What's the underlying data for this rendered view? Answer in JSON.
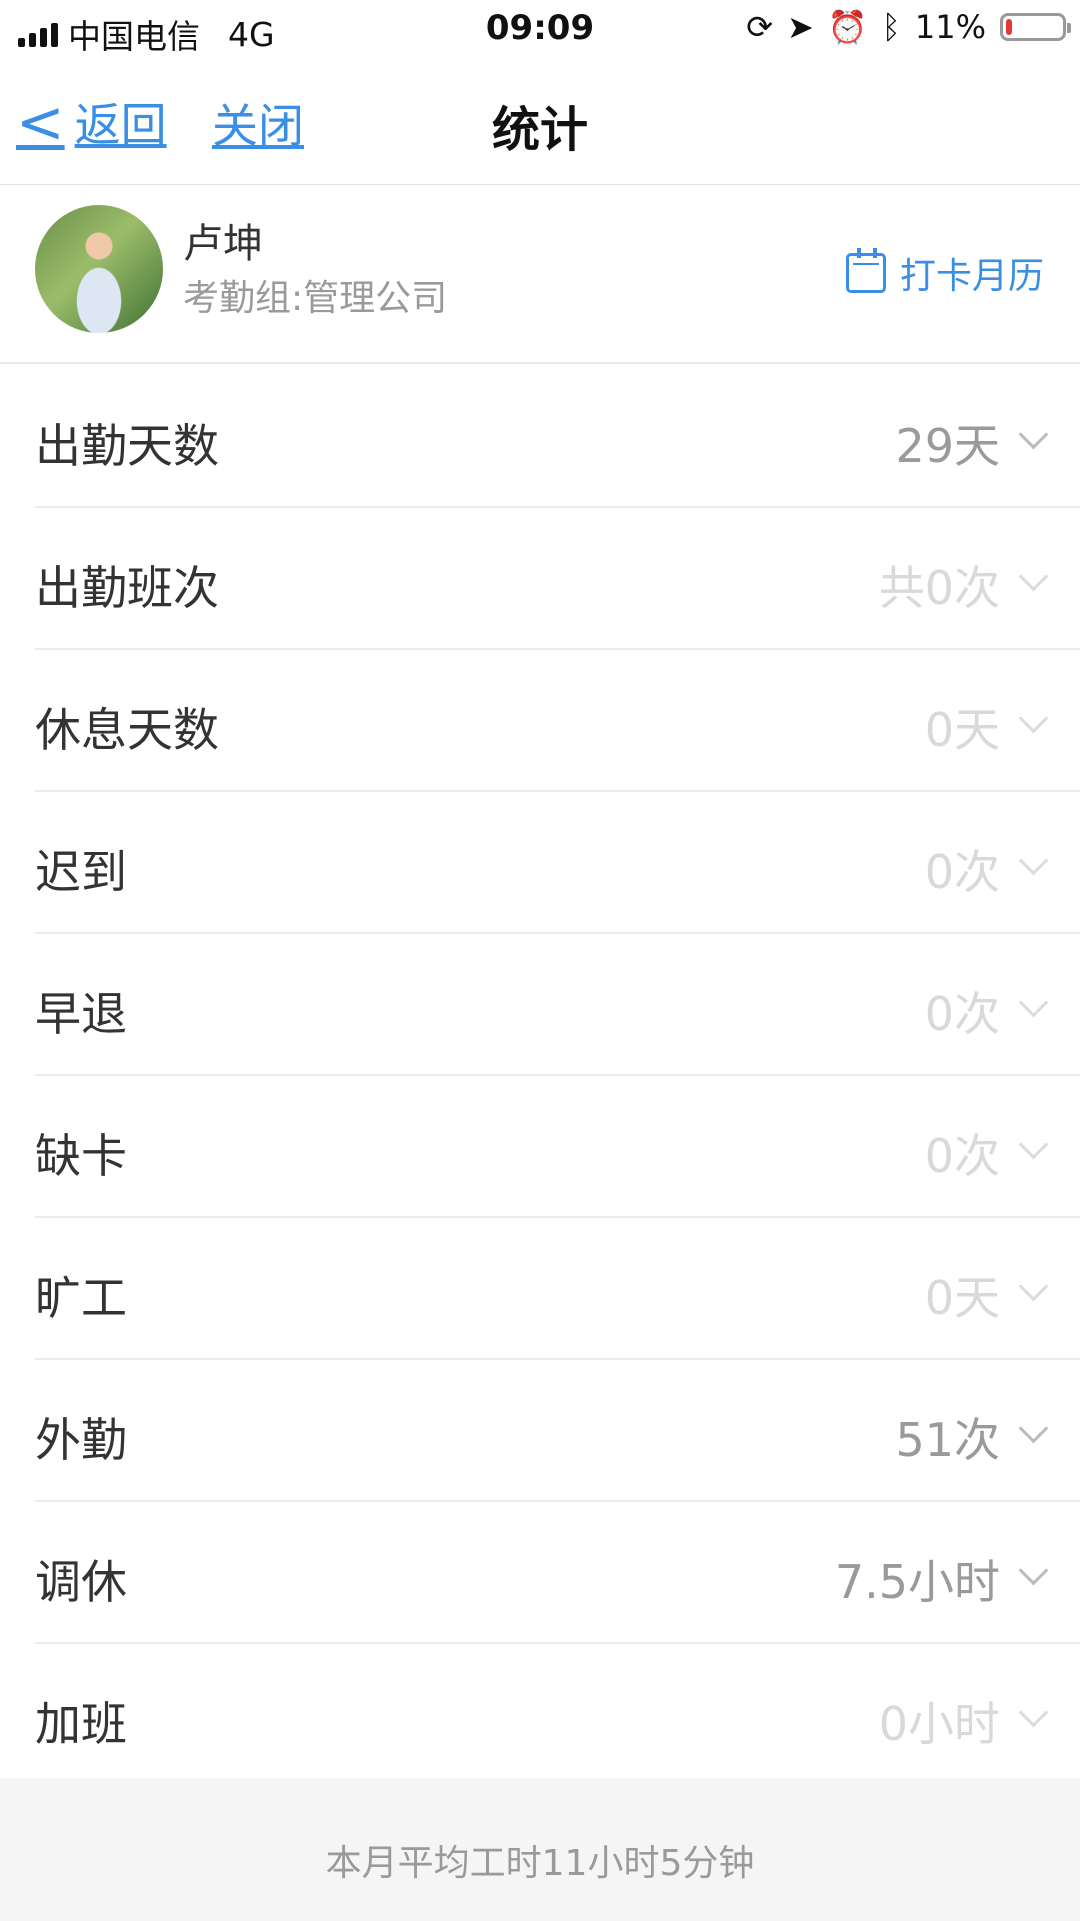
{
  "status_bar": {
    "carrier": "中国电信",
    "network": "4G",
    "time": "09:09",
    "battery": "11%",
    "battery_level": 0.11,
    "icons": [
      "rotation-lock-icon",
      "location-icon",
      "alarm-icon",
      "bluetooth-icon"
    ]
  },
  "nav": {
    "back_label": "返回",
    "close_label": "关闭",
    "title": "统计"
  },
  "profile": {
    "name": "卢坤",
    "group": "考勤组:管理公司",
    "calendar_label": "打卡月历"
  },
  "stats": [
    {
      "label": "出勤天数",
      "value": "29天",
      "active": true
    },
    {
      "label": "出勤班次",
      "value": "共0次",
      "active": false
    },
    {
      "label": "休息天数",
      "value": "0天",
      "active": false
    },
    {
      "label": "迟到",
      "value": "0次",
      "active": false
    },
    {
      "label": "早退",
      "value": "0次",
      "active": false
    },
    {
      "label": "缺卡",
      "value": "0次",
      "active": false
    },
    {
      "label": "旷工",
      "value": "0天",
      "active": false
    },
    {
      "label": "外勤",
      "value": "51次",
      "active": true
    },
    {
      "label": "调休",
      "value": "7.5小时",
      "active": true
    },
    {
      "label": "加班",
      "value": "0小时",
      "active": false
    }
  ],
  "footer": {
    "text": "本月平均工时11小时5分钟"
  }
}
